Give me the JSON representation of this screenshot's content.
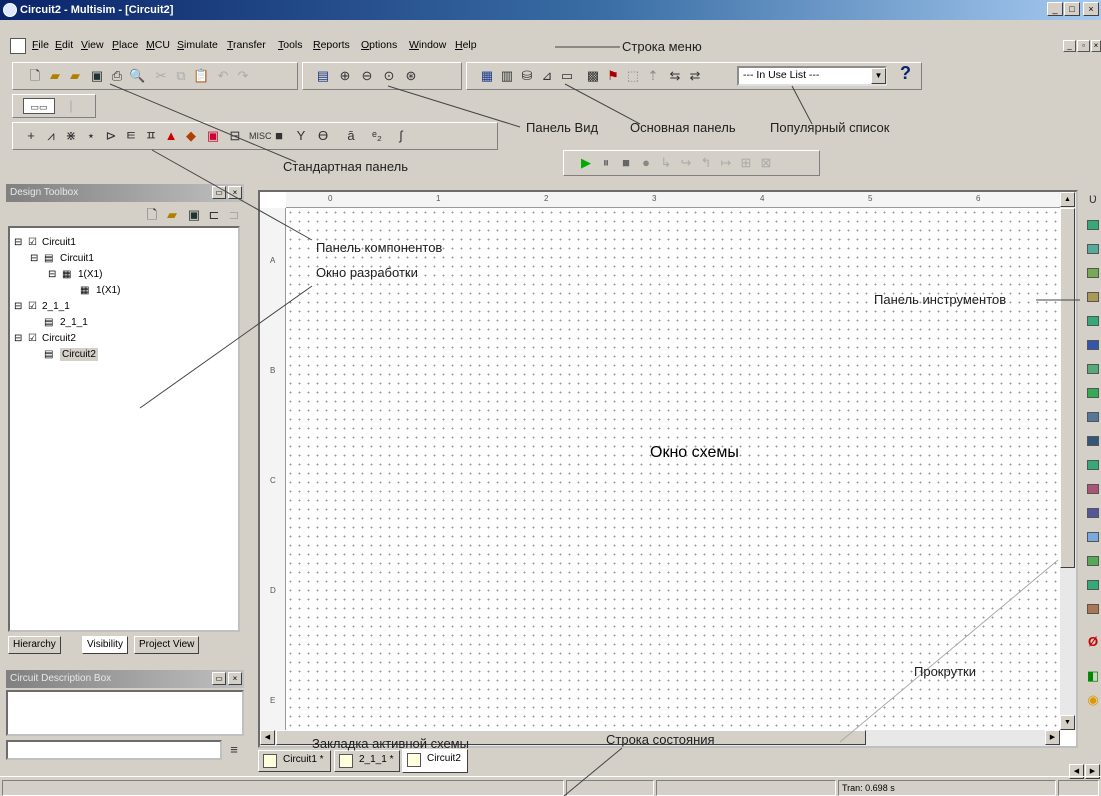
{
  "window": {
    "title": "Circuit2 - Multisim - [Circuit2]"
  },
  "menu": [
    {
      "label": "File"
    },
    {
      "label": "Edit"
    },
    {
      "label": "View"
    },
    {
      "label": "Place"
    },
    {
      "label": "MCU"
    },
    {
      "label": "Simulate"
    },
    {
      "label": "Transfer"
    },
    {
      "label": "Tools"
    },
    {
      "label": "Reports"
    },
    {
      "label": "Options"
    },
    {
      "label": "Window"
    },
    {
      "label": "Help"
    }
  ],
  "toolbar": {
    "in_use_list": "--- In Use List ---",
    "help_symbol": "?"
  },
  "design_toolbox": {
    "title": "Design Toolbox",
    "tree": [
      "Circuit1",
      "Circuit1",
      "1(X1)",
      "1(X1)",
      "2_1_1",
      "2_1_1",
      "Circuit2",
      "Circuit2"
    ],
    "tabs": [
      "Hierarchy",
      "Visibility",
      "Project View"
    ]
  },
  "circuit_description": {
    "title": "Circuit Description Box"
  },
  "schematic": {
    "ruler_top": [
      "0",
      "1",
      "2",
      "3",
      "4",
      "5",
      "6"
    ],
    "ruler_left": [
      "A",
      "B",
      "C",
      "D",
      "E"
    ]
  },
  "circuit_tabs": [
    "Circuit1 *",
    "2_1_1 *",
    "Circuit2"
  ],
  "status": {
    "tran": "Tran: 0.698 s"
  },
  "annotations": {
    "menu_bar": "Строка меню",
    "view_panel": "Панель Вид",
    "main_panel": "Основная панель",
    "popular_list": "Популярный список",
    "standard_panel": "Стандартная панель",
    "components_panel": "Панель компонентов",
    "design_window": "Окно разработки",
    "instruments_panel": "Панель инструментов",
    "schematic_window": "Окно схемы",
    "scrollbars": "Прокрутки",
    "active_tab": "Закладка активной схемы",
    "status_bar": "Строка состояния"
  }
}
